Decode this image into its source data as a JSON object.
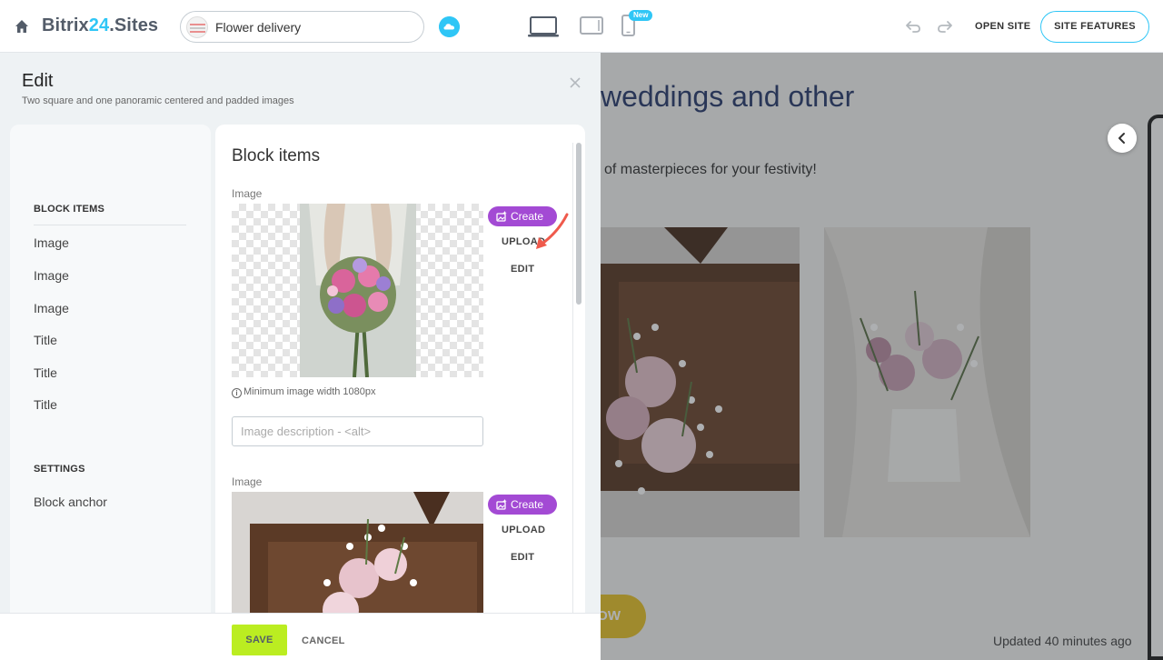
{
  "topbar": {
    "logo_prefix": "Bitrix",
    "logo_num": "24",
    "logo_suffix": ".Sites",
    "site_name": "Flower delivery",
    "new_badge": "New",
    "open_site": "OPEN SITE",
    "site_features": "SITE FEATURES",
    "icons": [
      "home-icon",
      "cloud-icon",
      "desktop-icon",
      "tablet-icon",
      "mobile-icon",
      "undo-icon",
      "redo-icon"
    ],
    "accent_color": "#2fc6f6"
  },
  "panel": {
    "title": "Edit",
    "subtitle": "Two square and one panoramic centered and padded images",
    "nav": {
      "block_items_heading": "BLOCK ITEMS",
      "items": [
        "Image",
        "Image",
        "Image",
        "Title",
        "Title",
        "Title"
      ],
      "settings_heading": "SETTINGS",
      "settings_items": [
        "Block anchor"
      ]
    },
    "editor": {
      "title": "Block items",
      "fields": [
        {
          "label": "Image",
          "create": "Create",
          "upload": "UPLOAD",
          "edit": "EDIT",
          "hint": "Minimum image width 1080px",
          "alt_placeholder": "Image description - <alt>"
        },
        {
          "label": "Image",
          "create": "Create",
          "upload": "UPLOAD",
          "edit": "EDIT"
        }
      ],
      "create_color": "#a34ad4"
    },
    "footer": {
      "save": "SAVE",
      "cancel": "CANCEL",
      "save_color": "#bbed21"
    }
  },
  "preview": {
    "heading": "weddings and other",
    "subtext": "of masterpieces for your festivity!",
    "button_text": "OW",
    "updated": "Updated 40 minutes ago"
  }
}
